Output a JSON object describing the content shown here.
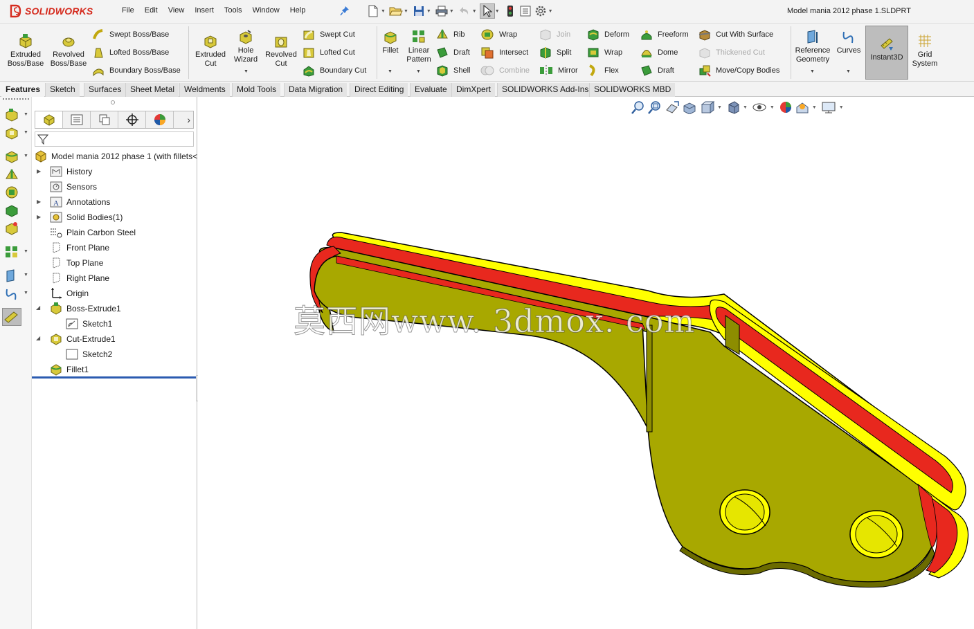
{
  "app": {
    "name": "SOLIDWORKS",
    "document_title": "Model mania 2012 phase 1.SLDPRT"
  },
  "menu": [
    "File",
    "Edit",
    "View",
    "Insert",
    "Tools",
    "Window",
    "Help"
  ],
  "ribbon": {
    "extruded_boss": "Extruded Boss/Base",
    "revolved_boss": "Revolved Boss/Base",
    "swept_boss": "Swept Boss/Base",
    "lofted_boss": "Lofted Boss/Base",
    "boundary_boss": "Boundary Boss/Base",
    "extruded_cut": "Extruded Cut",
    "hole_wizard": "Hole Wizard",
    "revolved_cut": "Revolved Cut",
    "swept_cut": "Swept Cut",
    "lofted_cut": "Lofted Cut",
    "boundary_cut": "Boundary Cut",
    "fillet": "Fillet",
    "linear_pattern": "Linear Pattern",
    "rib": "Rib",
    "draft": "Draft",
    "shell": "Shell",
    "wrap": "Wrap",
    "intersect": "Intersect",
    "combine": "Combine",
    "join": "Join",
    "split": "Split",
    "mirror": "Mirror",
    "deform": "Deform",
    "wrap2": "Wrap",
    "flex": "Flex",
    "freeform": "Freeform",
    "dome": "Dome",
    "draft2": "Draft",
    "cut_with_surface": "Cut With Surface",
    "thickened_cut": "Thickened Cut",
    "move_copy_bodies": "Move/Copy Bodies",
    "reference_geometry": "Reference Geometry",
    "curves": "Curves",
    "instant3d": "Instant3D",
    "grid_system": "Grid System"
  },
  "tabs": [
    "Features",
    "Sketch",
    "Surfaces",
    "Sheet Metal",
    "Weldments",
    "Mold Tools",
    "Data Migration",
    "Direct Editing",
    "Evaluate",
    "DimXpert",
    "SOLIDWORKS Add-Ins",
    "SOLIDWORKS MBD"
  ],
  "tree": {
    "root": "Model mania 2012 phase 1  (with fillets<",
    "items": [
      "History",
      "Sensors",
      "Annotations",
      "Solid Bodies(1)",
      "Plain Carbon Steel",
      "Front Plane",
      "Top Plane",
      "Right Plane",
      "Origin",
      "Boss-Extrude1",
      "Sketch1",
      "Cut-Extrude1",
      "Sketch2",
      "Fillet1"
    ]
  },
  "watermark": "莫西网www. 3dmox. com",
  "colors": {
    "part_yellow": "#FFFF00",
    "part_face": "#A8A800",
    "fillet_red": "#E8281E",
    "accent_red": "#D52B1E"
  }
}
